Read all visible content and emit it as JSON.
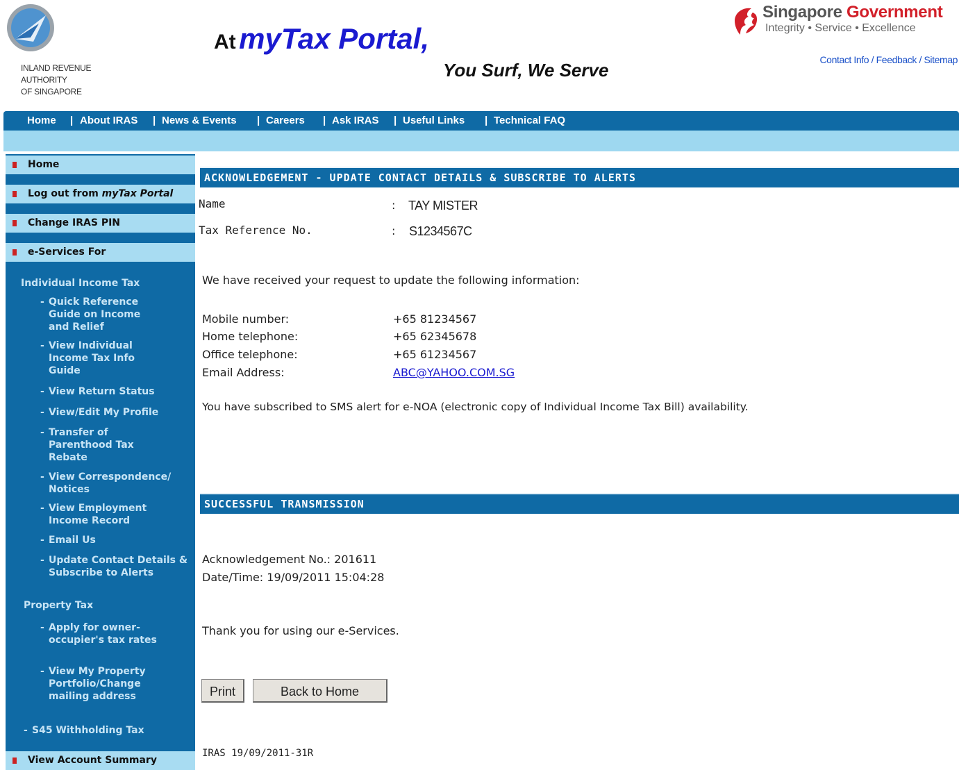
{
  "header": {
    "iras_name_lines": [
      "INLAND REVENUE",
      "AUTHORITY",
      "OF SINGAPORE"
    ],
    "title_at": "At",
    "title_my": "my",
    "title_tax_portal": "Tax Portal",
    "title_comma": ",",
    "slogan": "You Surf, We Serve",
    "gov_singapore": "Singapore",
    "gov_government": "Government",
    "gov_motto": "Integrity • Service • Excellence",
    "top_links": [
      "Contact Info",
      "Feedback",
      "Sitemap"
    ]
  },
  "nav": {
    "items": [
      "Home",
      "About IRAS",
      "News & Events",
      "Careers",
      "Ask IRAS",
      "Useful Links",
      "Technical FAQ"
    ]
  },
  "sidebar": {
    "home": "Home",
    "logout_prefix": "Log out from ",
    "logout_portal": "myTax Portal",
    "change_pin": "Change IRAS PIN",
    "eservices": "e-Services For",
    "section_iit": "Individual Income Tax",
    "iit_links": [
      "Quick Reference Guide on Income and Relief",
      "View Individual Income Tax Info Guide",
      "View Return Status",
      "View/Edit My Profile",
      "Transfer of Parenthood Tax Rebate",
      "View Correspondence/ Notices",
      "View Employment Income Record",
      "Email Us",
      "Update Contact Details & Subscribe to Alerts"
    ],
    "section_property": "Property Tax",
    "property_links": [
      "Apply for owner-occupier's tax rates",
      "View My Property Portfolio/Change mailing address"
    ],
    "s45": "S45 Withholding Tax",
    "view_account": "View Account Summary"
  },
  "main": {
    "ack_title": "ACKNOWLEDGEMENT - UPDATE CONTACT DETAILS & SUBSCRIBE TO ALERTS",
    "name_label": "Name",
    "name_colon": ":",
    "name_value": "TAY MISTER",
    "taxref_label": "Tax Reference No.",
    "taxref_colon": ":",
    "taxref_value": "S1234567C",
    "received_msg": "We have received your request to update the following information:",
    "mobile_label": "Mobile number:",
    "mobile_value": "+65 81234567",
    "home_label": "Home telephone:",
    "home_value": "+65 62345678",
    "office_label": "Office telephone:",
    "office_value": "+65 61234567",
    "email_label": "Email Address:",
    "email_value": "ABC@YAHOO.COM.SG",
    "subscribed_msg": "You have subscribed to SMS alert for e-NOA (electronic copy of Individual Income Tax Bill) availability.",
    "success_title": "SUCCESSFUL TRANSMISSION",
    "ack_no": "Acknowledgement No.: 201611",
    "datetime": "Date/Time: 19/09/2011 15:04:28",
    "thanks": "Thank you for using our e-Services.",
    "print_btn": "Print",
    "back_btn": "Back to Home",
    "footer_code": "IRAS 19/09/2011-31R"
  },
  "colors": {
    "nav_blue": "#0f6aa5",
    "light_blue": "#9ed8f0",
    "gov_red": "#d2202a",
    "link_blue": "#1a50c8"
  }
}
